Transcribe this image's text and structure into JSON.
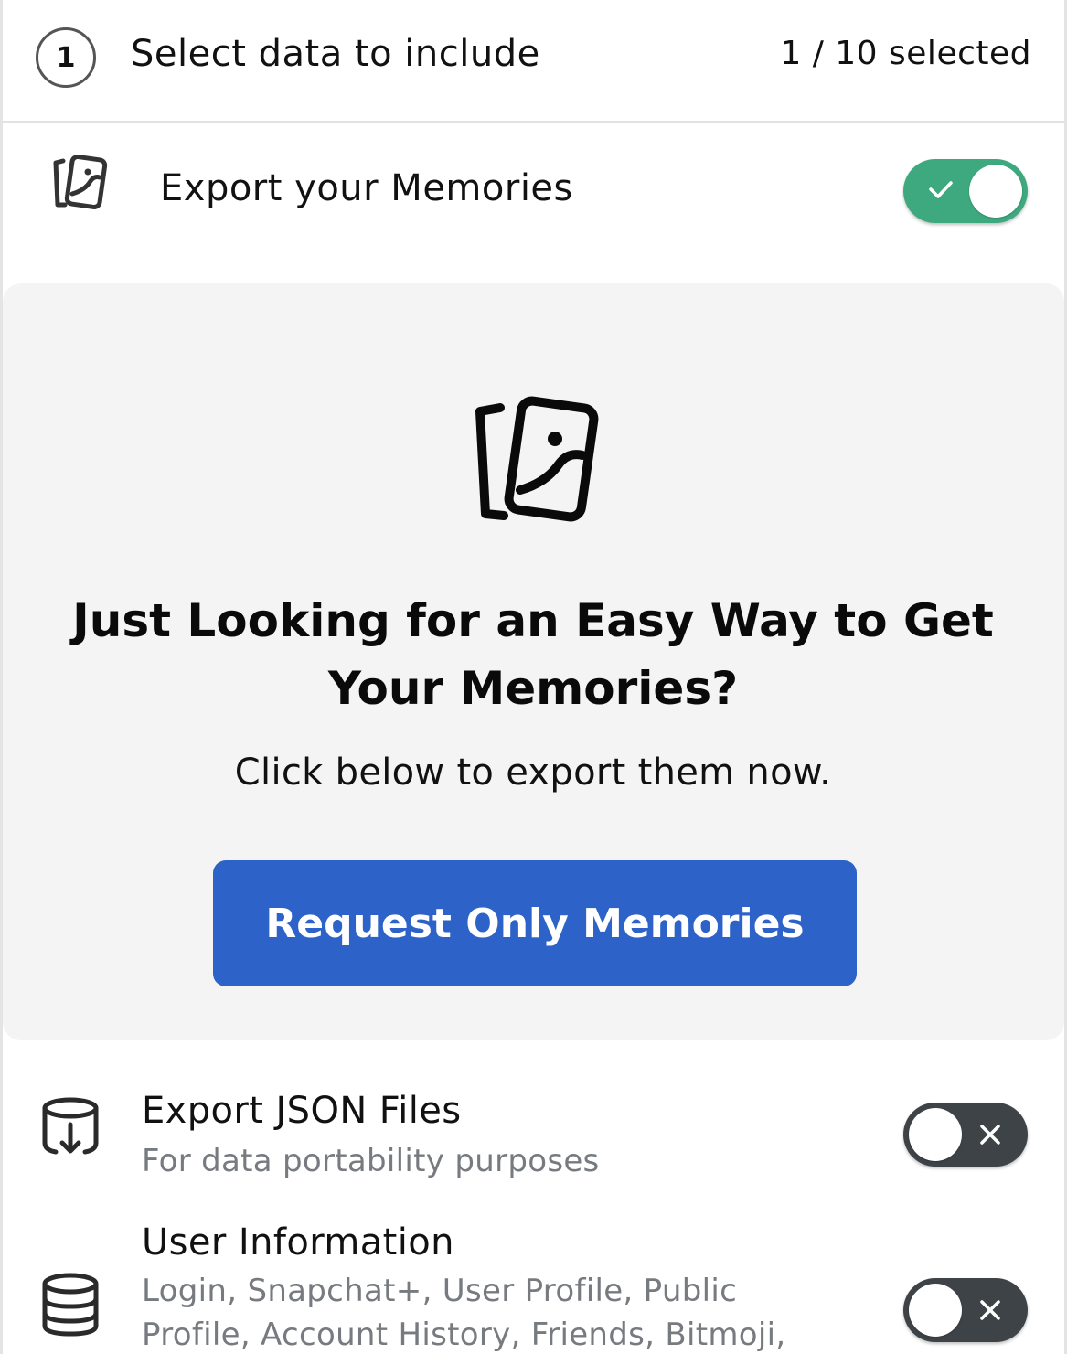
{
  "header": {
    "step_number": "1",
    "title": "Select data to include",
    "selected_count": "1 / 10 selected"
  },
  "memories_toggle": {
    "label": "Export your Memories",
    "state": "on",
    "icon": "memories-icon"
  },
  "promo": {
    "heading": "Just Looking for an Easy Way to Get Your Memories?",
    "subtitle": "Click below to export them now.",
    "button_label": "Request Only Memories",
    "icon": "memories-icon"
  },
  "options": [
    {
      "title": "Export JSON Files",
      "description": "For data portability purposes",
      "state": "off",
      "icon": "database-download-icon"
    },
    {
      "title": "User Information",
      "description": "Login, Snapchat+, User Profile, Public Profile, Account History, Friends, Bitmoji, Connected",
      "state": "off",
      "icon": "database-icon"
    }
  ],
  "colors": {
    "toggle_on": "#3ea97f",
    "toggle_off": "#3e4347",
    "primary_button": "#2d62c8",
    "card_background": "#f4f4f4",
    "secondary_text": "#777b80"
  }
}
